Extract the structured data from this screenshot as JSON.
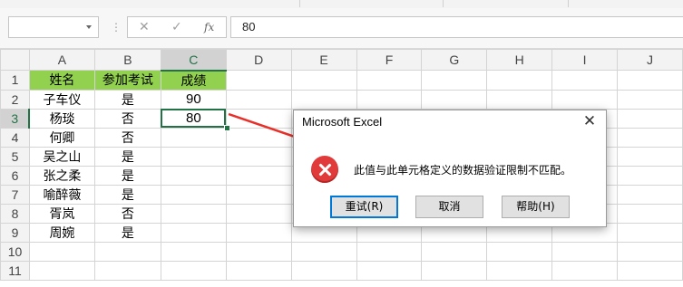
{
  "formula_bar": {
    "name_box": "",
    "cancel_icon": "✕",
    "enter_icon": "✓",
    "fx_label": "fx",
    "formula_value": "80"
  },
  "sheet": {
    "columns": [
      "A",
      "B",
      "C",
      "D",
      "E",
      "F",
      "G",
      "H",
      "I",
      "J"
    ],
    "rows": [
      "1",
      "2",
      "3",
      "4",
      "5",
      "6",
      "7",
      "8",
      "9",
      "10",
      "11"
    ],
    "cells": [
      [
        "姓名",
        "参加考试",
        "成绩"
      ],
      [
        "子车仪",
        "是",
        "90"
      ],
      [
        "杨琰",
        "否",
        "80"
      ],
      [
        "何卿",
        "否",
        ""
      ],
      [
        "吴之山",
        "是",
        ""
      ],
      [
        "张之柔",
        "是",
        ""
      ],
      [
        "喻醉薇",
        "是",
        ""
      ],
      [
        "胥岚",
        "否",
        ""
      ],
      [
        "周婉",
        "是",
        ""
      ],
      [
        "",
        "",
        ""
      ],
      [
        "",
        "",
        ""
      ]
    ],
    "active_cell": "C3",
    "header_fill_color": "#92d050",
    "selection_color": "#217346"
  },
  "dialog": {
    "title": "Microsoft Excel",
    "icon": "error-icon",
    "message": "此值与此单元格定义的数据验证限制不匹配。",
    "buttons": [
      "重试(R)",
      "取消",
      "帮助(H)"
    ]
  },
  "annotation": {
    "arrow_color": "#e8302a"
  }
}
